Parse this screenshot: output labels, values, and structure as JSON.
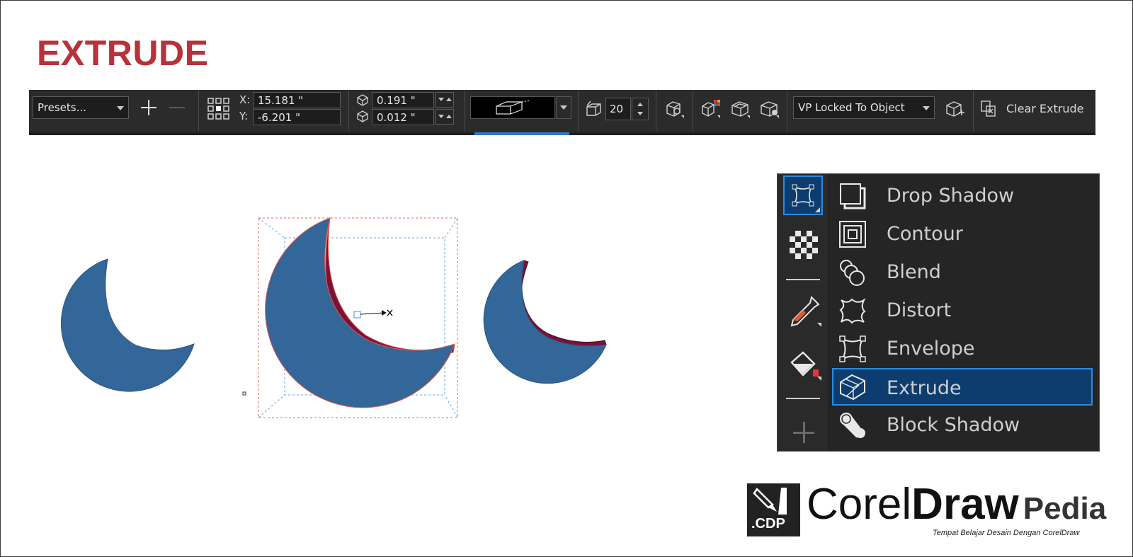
{
  "page": {
    "title": "EXTRUDE"
  },
  "propbar": {
    "presets_label": "Presets...",
    "x_label": "X:",
    "y_label": "Y:",
    "x_value": "15.181 \"",
    "y_value": "-6.201 \"",
    "depth_x": "0.191 \"",
    "depth_y": "0.012 \"",
    "depth_count": "20",
    "vp_mode": "VP Locked To Object",
    "clear_extrude": "Clear Extrude"
  },
  "effects_menu": {
    "items": [
      {
        "label": "Drop Shadow",
        "icon": "drop-shadow-icon"
      },
      {
        "label": "Contour",
        "icon": "contour-icon"
      },
      {
        "label": "Blend",
        "icon": "blend-icon"
      },
      {
        "label": "Distort",
        "icon": "distort-icon"
      },
      {
        "label": "Envelope",
        "icon": "envelope-icon"
      },
      {
        "label": "Extrude",
        "icon": "extrude-icon",
        "selected": true
      },
      {
        "label": "Block Shadow",
        "icon": "block-shadow-icon"
      }
    ]
  },
  "logo": {
    "badge": ".CDP",
    "word_corel": "Corel",
    "word_draw": "Draw",
    "word_pedia": "Pedia",
    "tagline": "Tempat Belajar Desain Dengan CorelDraw"
  },
  "colors": {
    "title_red": "#b8323a",
    "moon_blue": "#336699",
    "extrude_maroon": "#7a1238",
    "selection_blue": "#2c8bdb"
  }
}
